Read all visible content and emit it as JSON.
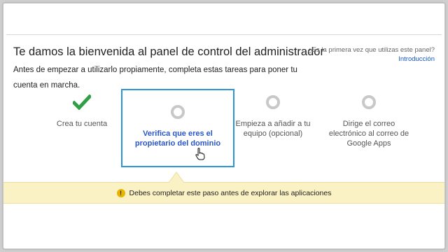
{
  "header": {
    "title": "Te damos la bienvenida al panel de control del administrador",
    "intro": "Antes de empezar a utilizarlo propiamente, completa estas tareas para poner tu cuenta en marcha."
  },
  "help": {
    "question": "¿Es la primera vez que utilizas este panel?",
    "link_label": "Introducción"
  },
  "steps": [
    {
      "label": "Crea tu cuenta",
      "status": "done",
      "icon": "checkmark-icon"
    },
    {
      "label": "Verifica que eres el propietario del dominio",
      "status": "current",
      "icon": "ring-icon"
    },
    {
      "label": "Empieza a añadir a tu equipo (opcional)",
      "status": "pending",
      "icon": "ring-icon"
    },
    {
      "label": "Dirige el correo electrónico al correo de Google Apps",
      "status": "pending",
      "icon": "ring-icon"
    }
  ],
  "banner": {
    "icon": "warning-icon",
    "icon_glyph": "!",
    "message": "Debes completar este paso antes de explorar las aplicaciones"
  },
  "colors": {
    "accent_border": "#2b95d6",
    "active_label": "#2a56c6",
    "done_check": "#2f9e44",
    "pending_ring": "#c8c8c8",
    "banner_bg": "#faf1c4",
    "link": "#1155cc"
  }
}
